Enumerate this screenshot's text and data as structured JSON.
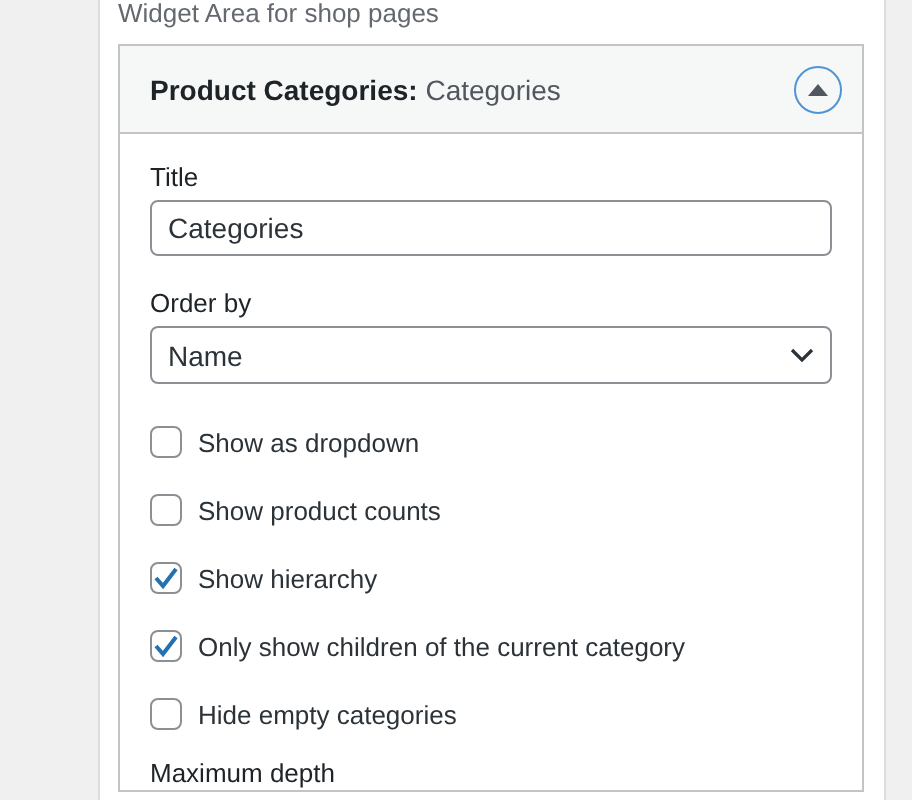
{
  "area_description": "Widget Area for shop pages",
  "widget": {
    "title_prefix": "Product Categories:",
    "title_name": "Categories",
    "expanded": true,
    "fields": [
      {
        "kind": "text",
        "label": "Title",
        "value": "Categories"
      },
      {
        "kind": "select",
        "label": "Order by",
        "value": "Name"
      }
    ],
    "options": [
      {
        "label": "Show as dropdown",
        "checked": false
      },
      {
        "label": "Show product counts",
        "checked": false
      },
      {
        "label": "Show hierarchy",
        "checked": true
      },
      {
        "label": "Only show children of the current category",
        "checked": true
      },
      {
        "label": "Hide empty categories",
        "checked": false
      }
    ],
    "trailing_label": "Maximum depth"
  }
}
